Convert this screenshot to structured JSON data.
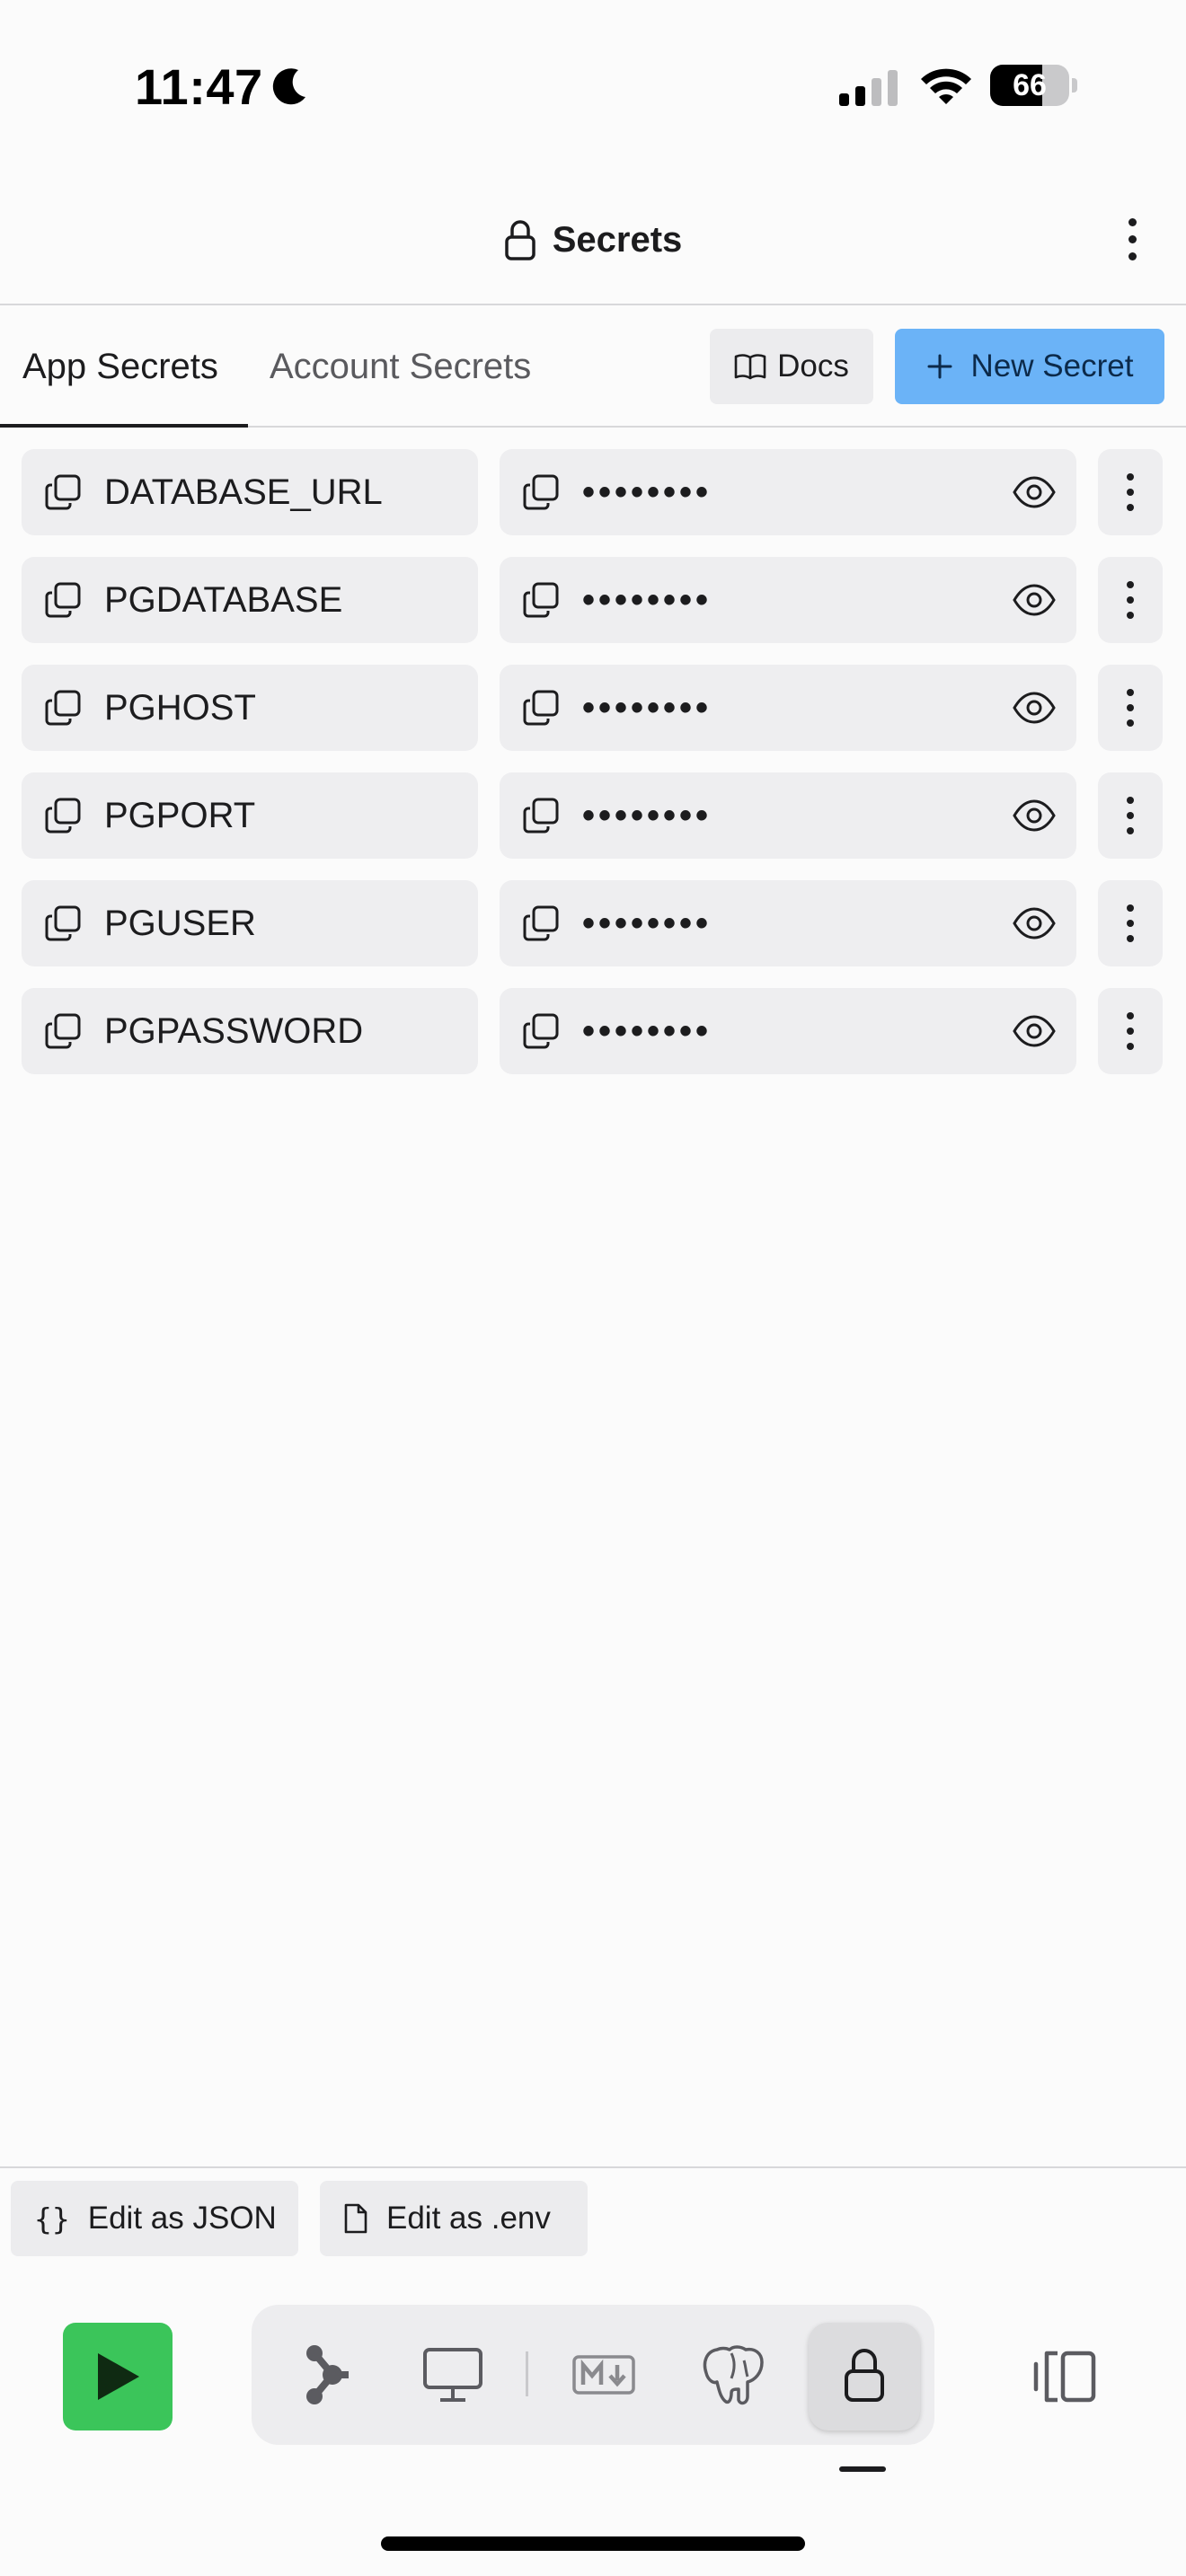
{
  "status_bar": {
    "time": "11:47",
    "battery_percent": "66",
    "battery_level": 0.66
  },
  "header": {
    "title": "Secrets"
  },
  "tabs": {
    "app_secrets": "App Secrets",
    "account_secrets": "Account Secrets",
    "docs_label": "Docs",
    "new_secret_label": "New Secret",
    "accent_color": "#6bb3f7"
  },
  "secrets": [
    {
      "key": "DATABASE_URL",
      "value": "••••••••"
    },
    {
      "key": "PGDATABASE",
      "value": "••••••••"
    },
    {
      "key": "PGHOST",
      "value": "••••••••"
    },
    {
      "key": "PGPORT",
      "value": "••••••••"
    },
    {
      "key": "PGUSER",
      "value": "••••••••"
    },
    {
      "key": "PGPASSWORD",
      "value": "••••••••"
    }
  ],
  "edit_bar": {
    "json_icon": "{}",
    "json_label": "Edit as JSON",
    "env_label": "Edit as .env"
  },
  "dock": {
    "run_color": "#3bc55a",
    "items": [
      "workflows-icon",
      "preview-monitor-icon",
      "markdown-icon",
      "postgres-elephant-icon",
      "lock-icon"
    ],
    "active_item": "lock-icon"
  }
}
